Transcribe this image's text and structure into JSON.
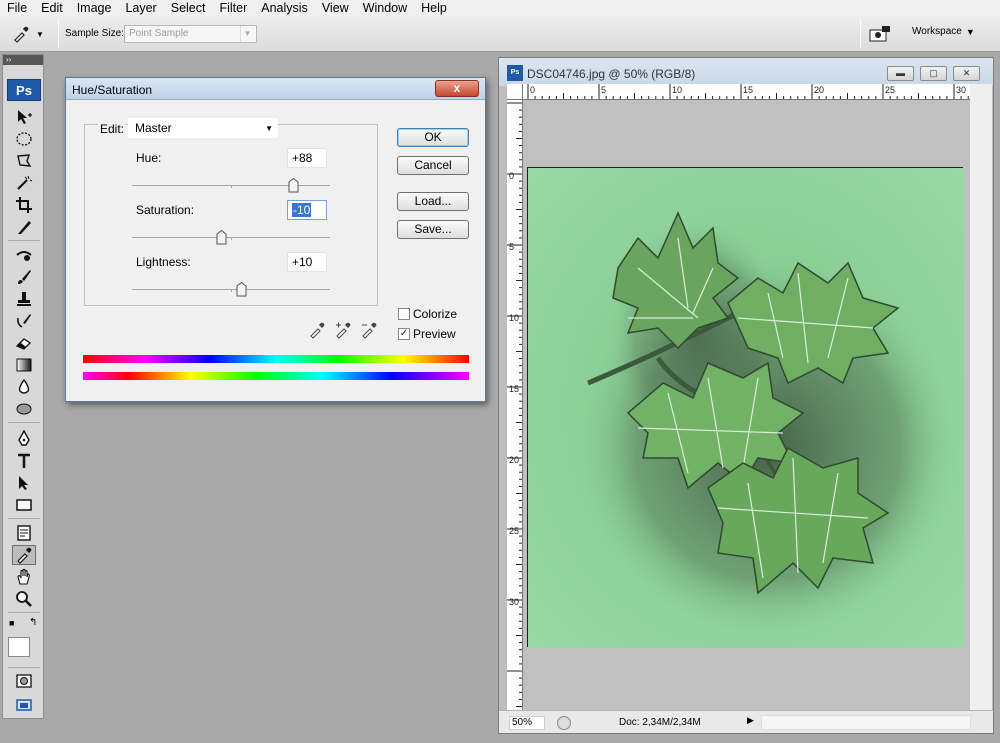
{
  "menubar": {
    "items": [
      "File",
      "Edit",
      "Image",
      "Layer",
      "Select",
      "Filter",
      "Analysis",
      "View",
      "Window",
      "Help"
    ]
  },
  "options_bar": {
    "sample_size_label": "Sample Size:",
    "sample_size_value": "Point Sample",
    "workspace_label": "Workspace"
  },
  "toolbox": {
    "logo": "Ps",
    "tools": [
      "move-tool",
      "marquee-tool",
      "lasso-tool",
      "magic-wand-tool",
      "crop-tool",
      "slice-tool",
      "healing-brush-tool",
      "brush-tool",
      "clone-stamp-tool",
      "history-brush-tool",
      "eraser-tool",
      "gradient-tool",
      "blur-tool",
      "dodge-tool",
      "pen-tool",
      "type-tool",
      "path-selection-tool",
      "shape-tool",
      "notes-tool",
      "eyedropper-tool",
      "hand-tool",
      "zoom-tool"
    ],
    "active_tool": "eyedropper-tool"
  },
  "dialog": {
    "title": "Hue/Saturation",
    "close_label": "x",
    "edit_label": "Edit:",
    "edit_value": "Master",
    "hue_label": "Hue:",
    "hue_value": "+88",
    "saturation_label": "Saturation:",
    "saturation_value": "-10",
    "lightness_label": "Lightness:",
    "lightness_value": "+10",
    "sliders": {
      "hue_fraction": 0.812,
      "saturation_fraction": 0.45,
      "lightness_fraction": 0.55
    },
    "buttons": {
      "ok": "OK",
      "cancel": "Cancel",
      "load": "Load...",
      "save": "Save..."
    },
    "colorize_label": "Colorize",
    "colorize_checked": false,
    "preview_label": "Preview",
    "preview_checked": true
  },
  "document": {
    "title": "DSC04746.jpg @ 50% (RGB/8)",
    "zoom": "50%",
    "doc_info": "Doc: 2,34M/2,34M",
    "ruler_top_labels": [
      "0",
      "5",
      "10",
      "15",
      "20",
      "25",
      "30"
    ],
    "ruler_left_labels": [
      "0",
      "5",
      "10",
      "15",
      "20",
      "25",
      "30"
    ]
  },
  "colors": {
    "photo_background": "#8fd39a",
    "leaf": "#6aa55f"
  }
}
